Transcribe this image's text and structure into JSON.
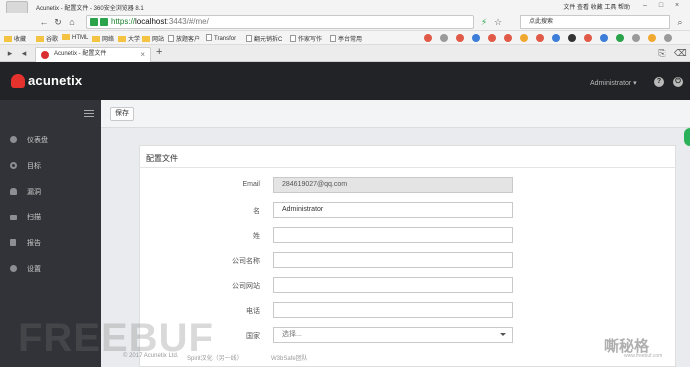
{
  "browser": {
    "window_title": "Acunetix - 配置文件 - 360安全浏览器 8.1",
    "menu": "文件  查看  收藏  工具  帮助",
    "url_scheme": "https://",
    "url_host": "localhost",
    "url_rest": ":3443/#/me/",
    "search_text": "点此搜索",
    "bookmarks": [
      "收藏",
      "谷歌",
      "HTML",
      "网络",
      "大学",
      "网站",
      "放题客户",
      "Transfor",
      "翻元销拆C",
      "作家写作",
      "亭台常用"
    ],
    "tab_label": "Acunetix - 配置文件",
    "new_tab": "+"
  },
  "header": {
    "logo": "acunetix",
    "user": "Administrator ▾",
    "help_icon": "?",
    "power_icon": "⏻"
  },
  "sidebar": {
    "items": [
      {
        "label": "仪表盘",
        "icon": "dashboard-icon"
      },
      {
        "label": "目标",
        "icon": "target-icon"
      },
      {
        "label": "漏洞",
        "icon": "bug-icon"
      },
      {
        "label": "扫描",
        "icon": "scan-icon"
      },
      {
        "label": "报告",
        "icon": "report-icon"
      },
      {
        "label": "设置",
        "icon": "gear-icon"
      }
    ]
  },
  "toolbar": {
    "save_label": "保存"
  },
  "profile": {
    "title": "配置文件",
    "fields": [
      {
        "label": "Email",
        "value": "284619027@qq.com",
        "readonly": true
      },
      {
        "label": "名",
        "value": "Administrator"
      },
      {
        "label": "姓",
        "value": ""
      },
      {
        "label": "公司名称",
        "value": ""
      },
      {
        "label": "公司网站",
        "value": ""
      },
      {
        "label": "电话",
        "value": ""
      },
      {
        "label": "国家",
        "value": "选择...",
        "select": true
      }
    ]
  },
  "footer": {
    "copyright": "© 2017 Acunetix Ltd.",
    "credit1": "Spirit汉化（另一线）",
    "credit2": "W3bSafe团队"
  },
  "watermarks": {
    "left": "FREEBUF",
    "right": "嘶秘格",
    "right_sub": "www.freebuf.com"
  }
}
